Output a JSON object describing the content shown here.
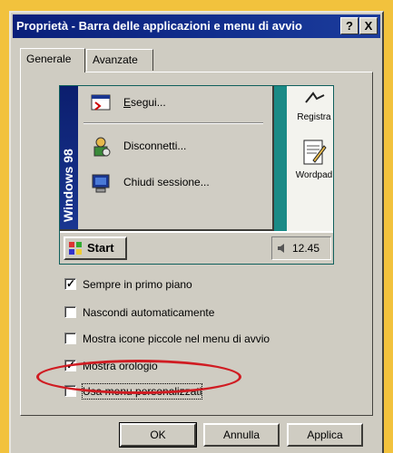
{
  "window": {
    "title": "Proprietà - Barra delle applicazioni e menu di avvio",
    "help_button": "?",
    "close_button": "X"
  },
  "tabs": [
    {
      "label": "Generale",
      "active": true
    },
    {
      "label": "Avanzate",
      "active": false
    }
  ],
  "preview": {
    "banner_text": "Windows 98",
    "start_menu_items": [
      {
        "label": "Esegui...",
        "icon": "run-icon"
      },
      {
        "label": "Disconnetti...",
        "icon": "logoff-icon"
      },
      {
        "label": "Chiudi sessione...",
        "icon": "shutdown-icon"
      }
    ],
    "desktop_icons": [
      {
        "label": "Registra",
        "icon": "sound-recorder-icon"
      },
      {
        "label": "Wordpad",
        "icon": "wordpad-icon"
      }
    ],
    "start_button": "Start",
    "clock": "12.45"
  },
  "options": [
    {
      "label": "Sempre in primo piano",
      "checked": true
    },
    {
      "label": "Nascondi automaticamente",
      "checked": false
    },
    {
      "label": "Mostra icone piccole nel menu di avvio",
      "checked": false
    },
    {
      "label": "Mostra orologio",
      "checked": true
    },
    {
      "label": "Usa menu personalizzati",
      "checked": false
    }
  ],
  "buttons": {
    "ok": "OK",
    "cancel": "Annulla",
    "apply": "Applica"
  },
  "colors": {
    "background": "#f2c23d",
    "titlebar": "#0a1f7a",
    "highlight_ellipse": "#d01c22",
    "desktop": "#1a8a86"
  }
}
